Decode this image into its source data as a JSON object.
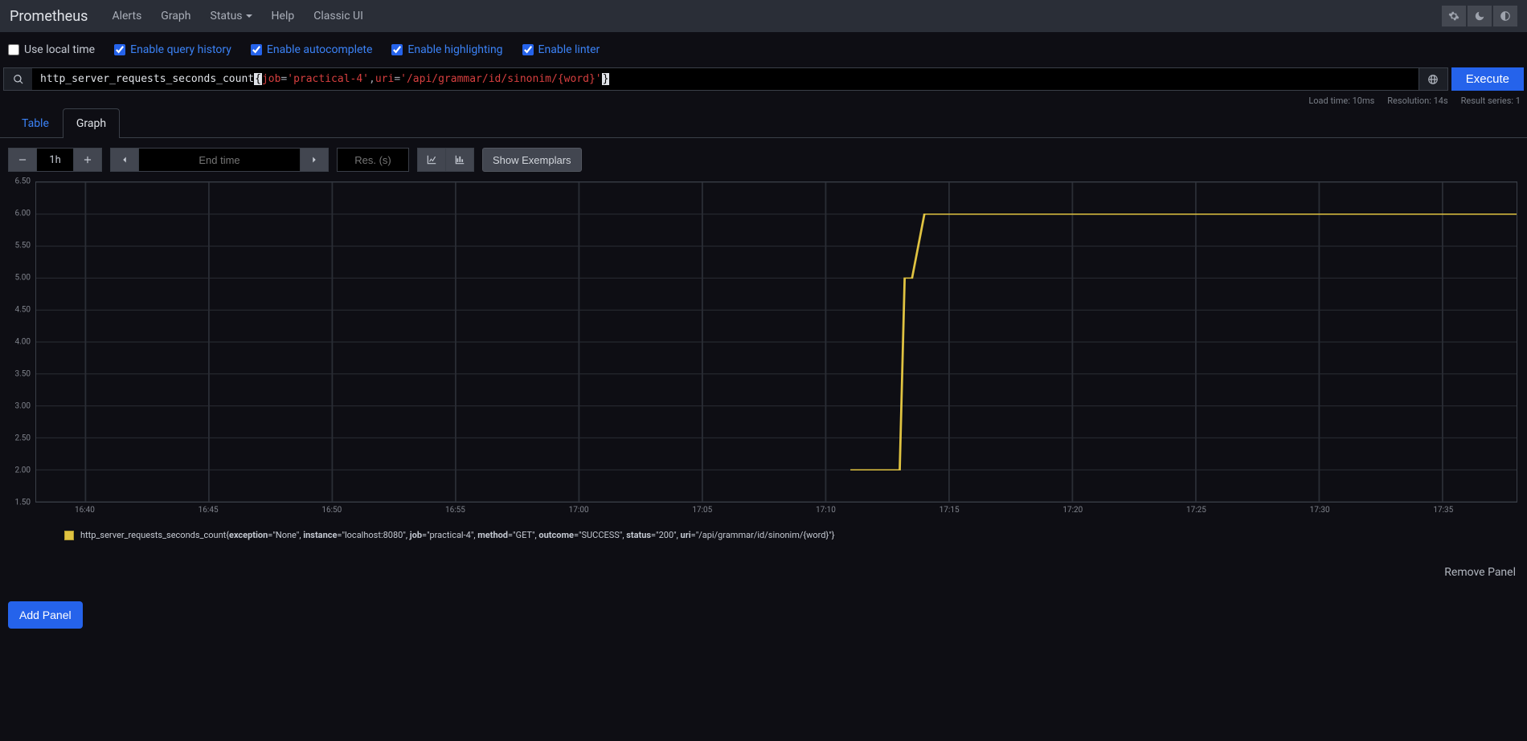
{
  "nav": {
    "brand": "Prometheus",
    "links": [
      "Alerts",
      "Graph",
      "Status",
      "Help",
      "Classic UI"
    ]
  },
  "options": {
    "use_local_time": "Use local time",
    "enable_history": "Enable query history",
    "enable_autocomplete": "Enable autocomplete",
    "enable_highlighting": "Enable highlighting",
    "enable_linter": "Enable linter"
  },
  "query": {
    "metric": "http_server_requests_seconds_count",
    "labels": [
      {
        "key": "job",
        "op": "=",
        "value": "'practical-4'"
      },
      {
        "key": "uri",
        "op": "=",
        "value": "'/api/grammar/id/sinonim/{word}'"
      }
    ],
    "execute": "Execute"
  },
  "meta": {
    "load": "Load time: 10ms",
    "resolution": "Resolution: 14s",
    "result": "Result series: 1"
  },
  "tabs": {
    "table": "Table",
    "graph": "Graph"
  },
  "controls": {
    "range": "1h",
    "end_time_placeholder": "End time",
    "res_placeholder": "Res. (s)",
    "show_exemplars": "Show Exemplars"
  },
  "chart_data": {
    "type": "line",
    "title": "",
    "xlabel": "",
    "ylabel": "",
    "ylim": [
      1.5,
      6.5
    ],
    "y_ticks": [
      "1.50",
      "2.00",
      "2.50",
      "3.00",
      "3.50",
      "4.00",
      "4.50",
      "5.00",
      "5.50",
      "6.00",
      "6.50"
    ],
    "x_ticks": [
      "16:40",
      "16:45",
      "16:50",
      "16:55",
      "17:00",
      "17:05",
      "17:10",
      "17:15",
      "17:20",
      "17:25",
      "17:30",
      "17:35"
    ],
    "series": [
      {
        "name": "http_server_requests_seconds_count",
        "points": [
          {
            "t": "17:11",
            "v": 2.0
          },
          {
            "t": "17:13",
            "v": 2.0
          },
          {
            "t": "17:13.2",
            "v": 5.0
          },
          {
            "t": "17:13.5",
            "v": 5.0
          },
          {
            "t": "17:14",
            "v": 6.0
          },
          {
            "t": "17:38",
            "v": 6.0
          }
        ]
      }
    ]
  },
  "legend": {
    "metric": "http_server_requests_seconds_count",
    "labels": [
      {
        "k": "exception",
        "v": "None"
      },
      {
        "k": "instance",
        "v": "localhost:8080"
      },
      {
        "k": "job",
        "v": "practical-4"
      },
      {
        "k": "method",
        "v": "GET"
      },
      {
        "k": "outcome",
        "v": "SUCCESS"
      },
      {
        "k": "status",
        "v": "200"
      },
      {
        "k": "uri",
        "v": "/api/grammar/id/sinonim/{word}"
      }
    ]
  },
  "footer": {
    "remove": "Remove Panel",
    "add": "Add Panel"
  }
}
